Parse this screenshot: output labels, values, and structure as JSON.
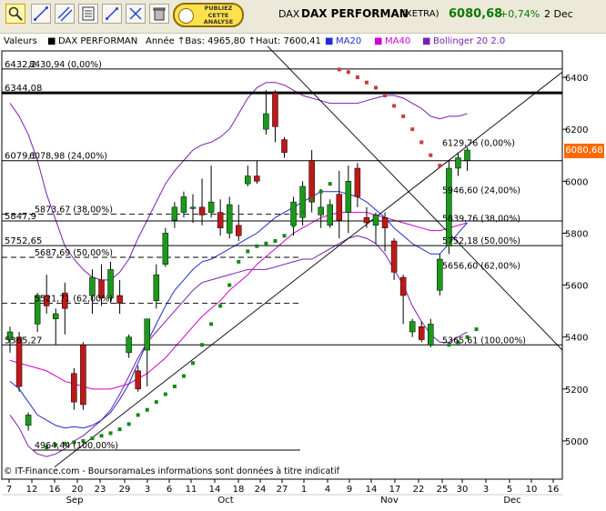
{
  "toolbar": {
    "buttons": [
      {
        "name": "zoom-icon"
      },
      {
        "name": "draw-line-icon"
      },
      {
        "name": "draw-lines-icon"
      },
      {
        "name": "indicators-icon"
      },
      {
        "name": "diagonal-up-icon"
      },
      {
        "name": "diagonal-cross-icon"
      },
      {
        "name": "trash-icon"
      }
    ],
    "publish": {
      "line1": "PUBLIEZ",
      "line2": "CETTE",
      "line3": "ANALYSE"
    }
  },
  "header": {
    "market": "DAX",
    "title": "DAX PERFORMAN",
    "exchange": "(XETRA)",
    "price": "6080,68",
    "change": "+0,74%",
    "date": "2 Dec"
  },
  "legend": {
    "valeurs": "Valeurs",
    "series_name": "DAX PERFORMAN",
    "range_text": "Année ↑Bas: 4965,80 ↑Haut: 7600,41",
    "ma20": "MA20",
    "ma40": "MA40",
    "bollinger": "Bollinger 20 2.0"
  },
  "colors": {
    "up": "#1a9a1a",
    "down": "#c01818",
    "ma20": "#1f2ccf",
    "ma40": "#d000d0",
    "bollinger": "#7a1fb0",
    "sar_green": "#138a13",
    "sar_red": "#c83c3c",
    "price_tag": "#ff6a00"
  },
  "footer": "© IT-Finance.com - BoursoramaLes informations sont données à titre indicatif",
  "chart_data": {
    "type": "candlestick",
    "ylim": [
      4900,
      6520
    ],
    "yticks": [
      5000,
      5200,
      5400,
      5600,
      5800,
      6000,
      6200,
      6400
    ],
    "ytick_labels": [
      "5000",
      "5200",
      "5400",
      "5600",
      "5800",
      "6000",
      "6200",
      "6400"
    ],
    "xtick_labels": [
      "7",
      "12",
      "16",
      "20",
      "23",
      "29",
      "3",
      "6",
      "11",
      "14",
      "18",
      "24",
      "27",
      "1",
      "4",
      "9",
      "14",
      "17",
      "22",
      "25",
      "30",
      "3",
      "5",
      "10",
      "16"
    ],
    "month_labels": [
      "Sep",
      "Oct",
      "Nov",
      "Dec"
    ],
    "current_price": "6080,68",
    "candles": [
      {
        "o": 5390,
        "c": 5420,
        "h": 5440,
        "l": 5340
      },
      {
        "o": 5400,
        "c": 5210,
        "h": 5420,
        "l": 5190
      },
      {
        "o": 5060,
        "c": 5100,
        "h": 5110,
        "l": 5040
      },
      {
        "o": 5450,
        "c": 5560,
        "h": 5570,
        "l": 5420
      },
      {
        "o": 5560,
        "c": 5520,
        "h": 5640,
        "l": 5490
      },
      {
        "o": 5470,
        "c": 5490,
        "h": 5510,
        "l": 5370
      },
      {
        "o": 5570,
        "c": 5510,
        "h": 5610,
        "l": 5410
      },
      {
        "o": 5260,
        "c": 5150,
        "h": 5280,
        "l": 5120
      },
      {
        "o": 5370,
        "c": 5140,
        "h": 5380,
        "l": 5120
      },
      {
        "o": 5560,
        "c": 5630,
        "h": 5660,
        "l": 5490
      },
      {
        "o": 5620,
        "c": 5550,
        "h": 5680,
        "l": 5520
      },
      {
        "o": 5550,
        "c": 5660,
        "h": 5690,
        "l": 5530
      },
      {
        "o": 5560,
        "c": 5530,
        "h": 5620,
        "l": 5490
      },
      {
        "o": 5340,
        "c": 5400,
        "h": 5410,
        "l": 5320
      },
      {
        "o": 5270,
        "c": 5200,
        "h": 5290,
        "l": 5190
      },
      {
        "o": 5350,
        "c": 5470,
        "h": 5470,
        "l": 5210
      },
      {
        "o": 5540,
        "c": 5640,
        "h": 5680,
        "l": 5510
      },
      {
        "o": 5680,
        "c": 5800,
        "h": 5820,
        "l": 5670
      },
      {
        "o": 5850,
        "c": 5900,
        "h": 5920,
        "l": 5820
      },
      {
        "o": 5880,
        "c": 5940,
        "h": 5960,
        "l": 5860
      },
      {
        "o": 5900,
        "c": 5900,
        "h": 5950,
        "l": 5840
      },
      {
        "o": 5900,
        "c": 5870,
        "h": 6010,
        "l": 5830
      },
      {
        "o": 5880,
        "c": 5920,
        "h": 6060,
        "l": 5860
      },
      {
        "o": 5880,
        "c": 5820,
        "h": 5930,
        "l": 5790
      },
      {
        "o": 5800,
        "c": 5910,
        "h": 5940,
        "l": 5780
      },
      {
        "o": 5830,
        "c": 5790,
        "h": 5910,
        "l": 5770
      },
      {
        "o": 5990,
        "c": 6020,
        "h": 6060,
        "l": 5980
      },
      {
        "o": 6020,
        "c": 6000,
        "h": 6080,
        "l": 5990
      },
      {
        "o": 6200,
        "c": 6260,
        "h": 6350,
        "l": 6180
      },
      {
        "o": 6340,
        "c": 6210,
        "h": 6350,
        "l": 6150
      },
      {
        "o": 6160,
        "c": 6110,
        "h": 6170,
        "l": 6090
      },
      {
        "o": 5830,
        "c": 5920,
        "h": 5940,
        "l": 5790
      },
      {
        "o": 5860,
        "c": 5980,
        "h": 6000,
        "l": 5830
      },
      {
        "o": 6080,
        "c": 5920,
        "h": 6120,
        "l": 5880
      },
      {
        "o": 5870,
        "c": 5900,
        "h": 5970,
        "l": 5820
      },
      {
        "o": 5830,
        "c": 5910,
        "h": 5930,
        "l": 5820
      },
      {
        "o": 5950,
        "c": 5850,
        "h": 6040,
        "l": 5780
      },
      {
        "o": 5880,
        "c": 6000,
        "h": 6060,
        "l": 5800
      },
      {
        "o": 6050,
        "c": 5940,
        "h": 6070,
        "l": 5900
      },
      {
        "o": 5860,
        "c": 5840,
        "h": 5900,
        "l": 5820
      },
      {
        "o": 5830,
        "c": 5870,
        "h": 5880,
        "l": 5760
      },
      {
        "o": 5860,
        "c": 5820,
        "h": 5880,
        "l": 5730
      },
      {
        "o": 5770,
        "c": 5650,
        "h": 5780,
        "l": 5620
      },
      {
        "o": 5630,
        "c": 5560,
        "h": 5640,
        "l": 5450
      },
      {
        "o": 5420,
        "c": 5460,
        "h": 5470,
        "l": 5400
      },
      {
        "o": 5440,
        "c": 5390,
        "h": 5460,
        "l": 5380
      },
      {
        "o": 5370,
        "c": 5450,
        "h": 5470,
        "l": 5360
      },
      {
        "o": 5580,
        "c": 5700,
        "h": 5720,
        "l": 5560
      },
      {
        "o": 5750,
        "c": 6050,
        "h": 6080,
        "l": 5720
      },
      {
        "o": 6050,
        "c": 6090,
        "h": 6110,
        "l": 6020
      },
      {
        "o": 6080,
        "c": 6120,
        "h": 6130,
        "l": 6040
      }
    ],
    "sar": [
      {
        "i": 4,
        "v": 4975,
        "side": "green"
      },
      {
        "i": 5,
        "v": 4985,
        "side": "green"
      },
      {
        "i": 6,
        "v": 4990,
        "side": "green"
      },
      {
        "i": 7,
        "v": 4995,
        "side": "green"
      },
      {
        "i": 8,
        "v": 5000,
        "side": "green"
      },
      {
        "i": 9,
        "v": 5010,
        "side": "green"
      },
      {
        "i": 10,
        "v": 5020,
        "side": "green"
      },
      {
        "i": 11,
        "v": 5030,
        "side": "green"
      },
      {
        "i": 12,
        "v": 5045,
        "side": "green"
      },
      {
        "i": 13,
        "v": 5065,
        "side": "green"
      },
      {
        "i": 14,
        "v": 5100,
        "side": "green"
      },
      {
        "i": 15,
        "v": 5120,
        "side": "green"
      },
      {
        "i": 16,
        "v": 5150,
        "side": "green"
      },
      {
        "i": 17,
        "v": 5180,
        "side": "green"
      },
      {
        "i": 18,
        "v": 5210,
        "side": "green"
      },
      {
        "i": 19,
        "v": 5250,
        "side": "green"
      },
      {
        "i": 20,
        "v": 5300,
        "side": "green"
      },
      {
        "i": 21,
        "v": 5370,
        "side": "green"
      },
      {
        "i": 22,
        "v": 5450,
        "side": "green"
      },
      {
        "i": 23,
        "v": 5520,
        "side": "green"
      },
      {
        "i": 24,
        "v": 5600,
        "side": "green"
      },
      {
        "i": 25,
        "v": 5690,
        "side": "green"
      },
      {
        "i": 26,
        "v": 5730,
        "side": "green"
      },
      {
        "i": 27,
        "v": 5750,
        "side": "green"
      },
      {
        "i": 28,
        "v": 5760,
        "side": "green"
      },
      {
        "i": 29,
        "v": 5770,
        "side": "green"
      },
      {
        "i": 30,
        "v": 5790,
        "side": "green"
      },
      {
        "i": 31,
        "v": 5830,
        "side": "green"
      },
      {
        "i": 32,
        "v": 5880,
        "side": "green"
      },
      {
        "i": 33,
        "v": 5930,
        "side": "green"
      },
      {
        "i": 34,
        "v": 5960,
        "side": "green"
      },
      {
        "i": 35,
        "v": 5990,
        "side": "green"
      },
      {
        "i": 36,
        "v": 6430,
        "side": "red"
      },
      {
        "i": 37,
        "v": 6420,
        "side": "red"
      },
      {
        "i": 38,
        "v": 6400,
        "side": "red"
      },
      {
        "i": 39,
        "v": 6380,
        "side": "red"
      },
      {
        "i": 40,
        "v": 6360,
        "side": "red"
      },
      {
        "i": 41,
        "v": 6330,
        "side": "red"
      },
      {
        "i": 42,
        "v": 6290,
        "side": "red"
      },
      {
        "i": 43,
        "v": 6250,
        "side": "red"
      },
      {
        "i": 44,
        "v": 6200,
        "side": "red"
      },
      {
        "i": 45,
        "v": 6150,
        "side": "red"
      },
      {
        "i": 46,
        "v": 6100,
        "side": "red"
      },
      {
        "i": 47,
        "v": 6060,
        "side": "red"
      },
      {
        "i": 48,
        "v": 5370,
        "side": "green"
      },
      {
        "i": 49,
        "v": 5380,
        "side": "green"
      },
      {
        "i": 50,
        "v": 5400,
        "side": "green"
      },
      {
        "i": 51,
        "v": 5430,
        "side": "green"
      }
    ],
    "ma20": [
      5230,
      5200,
      5150,
      5100,
      5080,
      5060,
      5050,
      5055,
      5050,
      5060,
      5080,
      5110,
      5160,
      5220,
      5300,
      5380,
      5450,
      5520,
      5580,
      5620,
      5660,
      5690,
      5700,
      5720,
      5740,
      5760,
      5780,
      5800,
      5830,
      5860,
      5880,
      5900,
      5920,
      5940,
      5960,
      5960,
      5960,
      5950,
      5940,
      5920,
      5890,
      5860,
      5820,
      5790,
      5760,
      5740,
      5720,
      5720,
      5760,
      5800,
      5840
    ],
    "ma40": [
      5310,
      5300,
      5290,
      5280,
      5270,
      5250,
      5230,
      5220,
      5210,
      5200,
      5200,
      5200,
      5210,
      5220,
      5240,
      5260,
      5290,
      5320,
      5360,
      5400,
      5440,
      5480,
      5510,
      5540,
      5580,
      5610,
      5640,
      5680,
      5710,
      5740,
      5770,
      5800,
      5820,
      5840,
      5860,
      5870,
      5880,
      5880,
      5880,
      5880,
      5870,
      5860,
      5850,
      5840,
      5830,
      5820,
      5810,
      5810,
      5820,
      5830,
      5840
    ],
    "boll_upper": [
      6300,
      6250,
      6180,
      6080,
      5950,
      5850,
      5750,
      5700,
      5660,
      5630,
      5620,
      5620,
      5650,
      5700,
      5780,
      5850,
      5920,
      5990,
      6040,
      6080,
      6120,
      6140,
      6150,
      6170,
      6200,
      6260,
      6320,
      6360,
      6380,
      6380,
      6370,
      6350,
      6330,
      6320,
      6310,
      6300,
      6300,
      6300,
      6300,
      6310,
      6320,
      6330,
      6330,
      6320,
      6300,
      6280,
      6250,
      6240,
      6250,
      6250,
      6260
    ],
    "boll_lower": [
      5100,
      5050,
      4980,
      4950,
      4940,
      4950,
      4970,
      5000,
      5020,
      5050,
      5080,
      5120,
      5180,
      5250,
      5320,
      5380,
      5420,
      5460,
      5500,
      5540,
      5580,
      5610,
      5620,
      5630,
      5640,
      5650,
      5660,
      5660,
      5660,
      5670,
      5680,
      5690,
      5700,
      5700,
      5720,
      5740,
      5760,
      5780,
      5790,
      5780,
      5760,
      5720,
      5660,
      5600,
      5520,
      5460,
      5410,
      5380,
      5380,
      5400,
      5420
    ],
    "horizontal_levels": [
      {
        "v": 6432,
        "label": "6432,2"
      },
      {
        "v": 6340,
        "label": "6344,08"
      },
      {
        "v": 6079,
        "label": "6079,1"
      },
      {
        "v": 5847,
        "label": "5847,9"
      },
      {
        "v": 5752,
        "label": "5752,65"
      },
      {
        "v": 5370,
        "label": "5365,27"
      }
    ],
    "fib_left": [
      {
        "v": 6432,
        "label": "8430,94 (0,00%)"
      },
      {
        "v": 6079,
        "label": "6078,98 (24,00%)"
      },
      {
        "v": 5873,
        "label": "5873,67 (38,00%)"
      },
      {
        "v": 5707,
        "label": "5687,69 (50,00%)"
      },
      {
        "v": 5530,
        "label": "5521,71 (62,00%)"
      },
      {
        "v": 4965,
        "label": "4964,44 (100,00%)"
      }
    ],
    "fib_right": [
      {
        "v": 6129,
        "label": "6129,76 (0,00%)"
      },
      {
        "v": 5946,
        "label": "5946,60 (24,00%)"
      },
      {
        "v": 5839,
        "label": "5839,76 (38,00%)"
      },
      {
        "v": 5752,
        "label": "5752,18 (50,00%)"
      },
      {
        "v": 5656,
        "label": "5656,60 (62,00%)"
      },
      {
        "v": 5370,
        "label": "5365,61 (100,00%)"
      }
    ]
  }
}
